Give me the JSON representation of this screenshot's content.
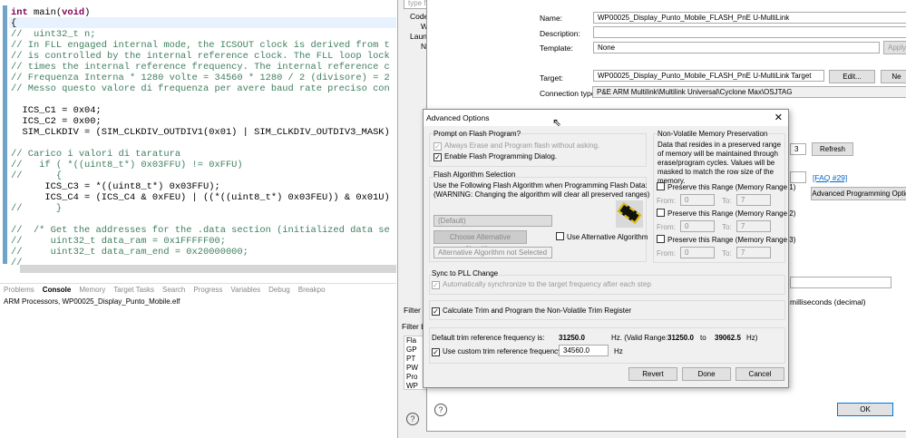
{
  "editor": {
    "lines": [
      "int main(void)",
      "{",
      "//  uint32_t n;",
      "// In FLL engaged internal mode, the ICSOUT clock is derived from t",
      "// is controlled by the internal reference clock. The FLL loop lock",
      "// times the internal reference frequency. The internal reference c",
      "// Frequenza Interna * 1280 volte = 34560 * 1280 / 2 (divisore) = 2",
      "// Messo questo valore di frequenza per avere baud rate preciso con",
      "",
      "  ICS_C1 = 0x04;",
      "  ICS_C2 = 0x00;",
      "  SIM_CLKDIV = (SIM_CLKDIV_OUTDIV1(0x01) | SIM_CLKDIV_OUTDIV3_MASK)",
      "",
      "// Carico i valori di taratura",
      "//   if ( *((uint8_t*) 0x03FFU) != 0xFFU)",
      "//      {",
      "      ICS_C3 = *((uint8_t*) 0x03FFU);",
      "      ICS_C4 = (ICS_C4 & 0xFEU) | ((*((uint8_t*) 0x03FEU)) & 0x01U)",
      "//      }",
      "",
      "//  /* Get the addresses for the .data section (initialized data se",
      "//     uint32_t data_ram = 0x1FFFFF00;",
      "//     uint32_t data_ram_end = 0x20000000;",
      "//"
    ]
  },
  "console": {
    "tabs": [
      "Problems",
      "Console",
      "Memory",
      "Target Tasks",
      "Search",
      "Progress",
      "Variables",
      "Debug",
      "Breakpo"
    ],
    "text": "ARM Processors, WP00025_Display_Punto_Mobile.elf"
  },
  "left_tree": {
    "filter_placeholder": "type filt",
    "items": [
      "Code",
      "W",
      "Laun",
      "N"
    ],
    "filter_label": "Filter m",
    "filter_by": "Filter by",
    "folders": [
      "Fla",
      "GP",
      "PT",
      "PW",
      "Pro",
      "WP"
    ]
  },
  "config": {
    "name_label": "Name:",
    "name": "WP00025_Display_Punto_Mobile_FLASH_PnE U-MultiLink",
    "description_label": "Description:",
    "description": "",
    "template_label": "Template:",
    "template": "None",
    "apply_label": "Apply",
    "target_label": "Target:",
    "target": "WP00025_Display_Punto_Mobile_FLASH_PnE U-MultiLink Target",
    "edit_label": "Edit...",
    "new_label": "Ne",
    "connection_label": "Connection type:",
    "connection": "P&E ARM Multilink\\Multilink Universal\\Cyclone Max\\OSJTAG",
    "refresh_label": "Refresh",
    "faq_link": "[FAQ #29]",
    "adv_prog_label": "Advanced Programming Optio",
    "ms_label": "milliseconds (decimal)",
    "ok_label": "OK",
    "combo_partial": "3"
  },
  "advanced": {
    "title": "Advanced Options",
    "prompt_group": "Prompt on Flash Program?",
    "always_erase": "Always Erase and Program flash without asking.",
    "enable_dialog": "Enable Flash Programming Dialog.",
    "algo_group": "Flash Algorithm Selection",
    "algo_text1": "Use the Following Flash Algorithm when Programming Flash Data:",
    "algo_text2": "(WARNING: Changing the algorithm will clear all preserved ranges)",
    "algo_select": "(Default)",
    "choose_alt": "Choose Alternative Algorithm",
    "use_alt": "Use Alternative Algorithm",
    "alt_status": "Alternative Algorithm not Selected",
    "nv_group": "Non-Volatile Memory Preservation",
    "nv_text": "Data that resides in a preserved range of memory will be maintained through erase/program cycles. Values will be masked to match the row size of the memory.",
    "ranges": [
      {
        "label": "Preserve this Range (Memory Range 1)",
        "from": "0",
        "to": "7"
      },
      {
        "label": "Preserve this Range (Memory Range 2)",
        "from": "0",
        "to": "7"
      },
      {
        "label": "Preserve this Range (Memory Range 3)",
        "from": "0",
        "to": "7"
      }
    ],
    "from_label": "From:",
    "to_label": "To:",
    "sync_group": "Sync to PLL Change",
    "sync_text": "Automatically synchronize to the target frequency after each step",
    "calc_trim": "Calculate Trim and Program the Non-Volatile Trim Register",
    "default_trim_label": "Default trim reference frequency is:",
    "default_trim": "31250.0",
    "valid_range_prefix": "Hz. (Valid Range:",
    "range_min": "31250.0",
    "range_to": "to",
    "range_max": "39062.5",
    "range_suffix": "Hz)",
    "custom_trim_label": "Use custom trim reference frequency:",
    "custom_trim": "34560.0",
    "hz": "Hz",
    "revert": "Revert",
    "done": "Done",
    "cancel": "Cancel"
  }
}
